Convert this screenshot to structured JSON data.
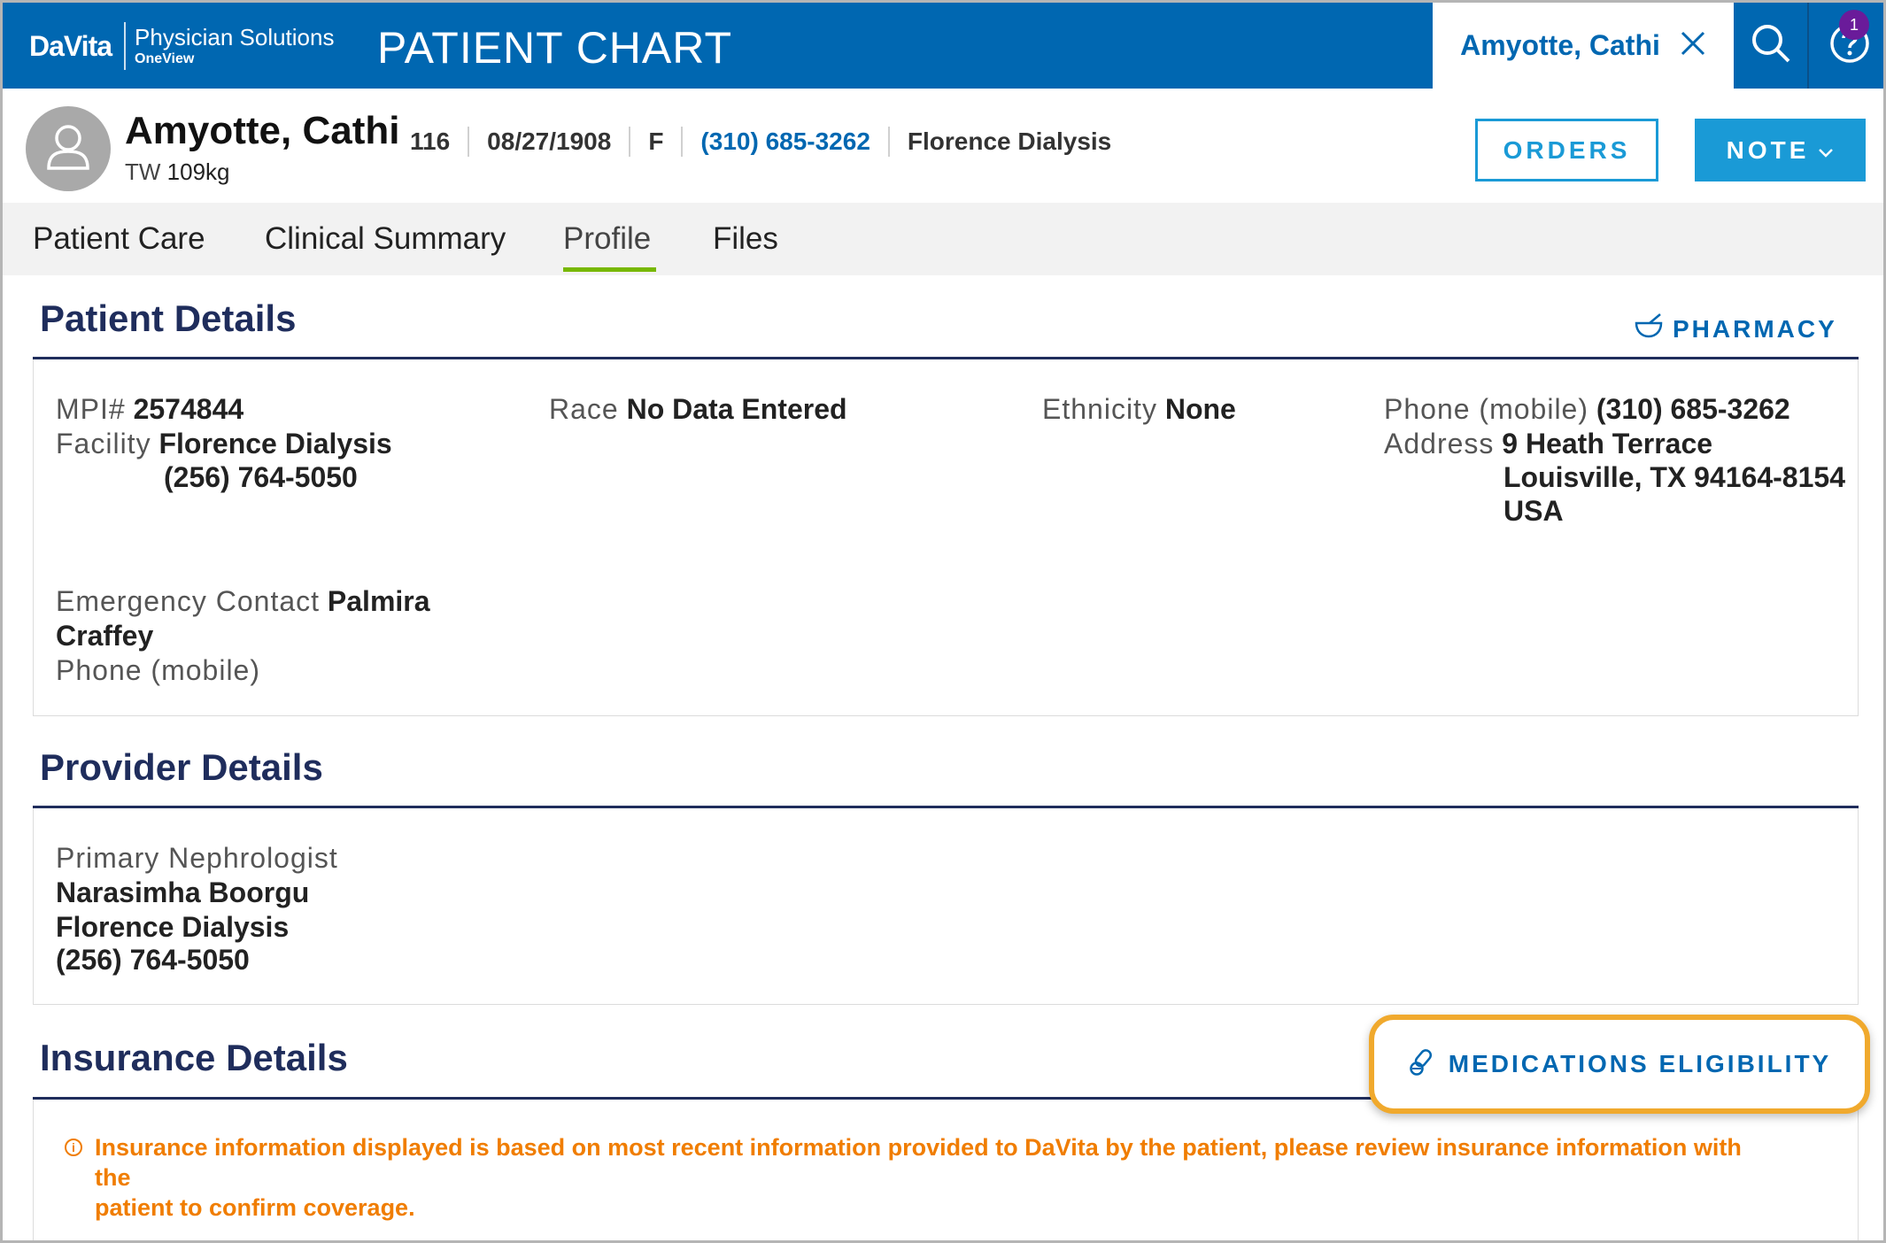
{
  "header": {
    "logo_brand": "DaVita",
    "logo_line1": "Physician Solutions",
    "logo_line2": "OneView",
    "app_title": "PATIENT CHART",
    "open_patient_tab": "Amyotte, Cathi",
    "help_badge_count": "1",
    "colors": {
      "bar": "#0067b1",
      "accent": "#1a9ad6",
      "badge": "#6a1b9a"
    }
  },
  "patient": {
    "name": "Amyotte, Cathi",
    "tw_label": "TW",
    "tw_value": "109kg",
    "meta": [
      "116",
      "08/27/1908",
      "F"
    ],
    "phone": "(310) 685-3262",
    "facility": "Florence Dialysis"
  },
  "actions": {
    "orders_label": "ORDERS",
    "note_label": "NOTE"
  },
  "tabs": [
    {
      "label": "Patient Care"
    },
    {
      "label": "Clinical Summary"
    },
    {
      "label": "Profile",
      "active": true
    },
    {
      "label": "Files"
    }
  ],
  "patient_details": {
    "title": "Patient Details",
    "pharmacy_label": "PHARMACY",
    "mpi_label": "MPI#",
    "mpi_value": "2574844",
    "facility_label": "Facility",
    "facility_value": "Florence Dialysis",
    "facility_phone": "(256) 764-5050",
    "race_label": "Race",
    "race_value": "No Data Entered",
    "ethnicity_label": "Ethnicity",
    "ethnicity_value": "None",
    "phone_label": "Phone (mobile)",
    "phone_value": "(310) 685-3262",
    "address_label": "Address",
    "address_lines": [
      "9 Heath Terrace",
      "Louisville, TX 94164-8154",
      "USA"
    ],
    "emergency_label": "Emergency Contact",
    "emergency_name_1": "Palmira",
    "emergency_name_2": "Craffey",
    "emergency_phone_label": "Phone (mobile)"
  },
  "provider_details": {
    "title": "Provider Details",
    "role_label": "Primary Nephrologist",
    "name": "Narasimha Boorgu",
    "facility": "Florence Dialysis",
    "phone": "(256) 764-5050"
  },
  "insurance_details": {
    "title": "Insurance Details",
    "medications_eligibility_label": "MEDICATIONS ELIGIBILITY",
    "notice_line1": "Insurance information displayed is based on most recent information provided to DaVita by the patient, please review insurance information with the",
    "notice_line2": "patient to confirm coverage.",
    "notice_color": "#f07d00"
  }
}
